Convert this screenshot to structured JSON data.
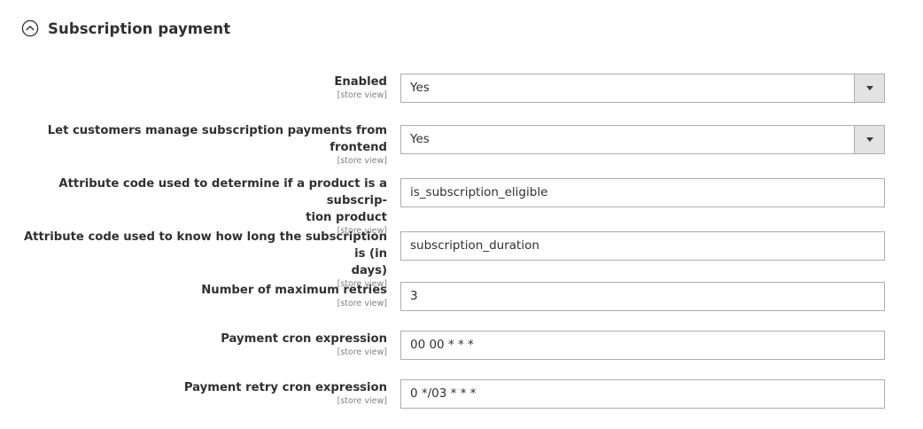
{
  "section": {
    "title": "Subscription payment",
    "icon": "chevron-up-circle-icon"
  },
  "fields": [
    {
      "label_lines": [
        "Enabled"
      ],
      "scope": "[store view]",
      "type": "select",
      "value": "Yes"
    },
    {
      "label_lines": [
        "Let customers manage subscription payments from",
        "frontend"
      ],
      "scope": "[store view]",
      "type": "select",
      "value": "Yes"
    },
    {
      "label_lines": [
        "Attribute code used to determine if a product is a subscrip-",
        "tion product"
      ],
      "scope": "[store view]",
      "type": "text",
      "value": "is_subscription_eligible"
    },
    {
      "label_lines": [
        "Attribute code used to know how long the subscription is (in",
        "days)"
      ],
      "scope": "[store view]",
      "type": "text",
      "value": "subscription_duration"
    },
    {
      "label_lines": [
        "Number of maximum retries"
      ],
      "scope": "[store view]",
      "type": "text",
      "value": "3"
    },
    {
      "label_lines": [
        "Payment cron expression"
      ],
      "scope": "[store view]",
      "type": "text",
      "value": "00 00 * * *"
    },
    {
      "label_lines": [
        "Payment retry cron expression"
      ],
      "scope": "[store view]",
      "type": "text",
      "value": "0 */03 * * *"
    }
  ],
  "colors": {
    "text": "#303030",
    "scope": "#808080",
    "border": "#adadad",
    "select_button": "#e3e3e3"
  }
}
